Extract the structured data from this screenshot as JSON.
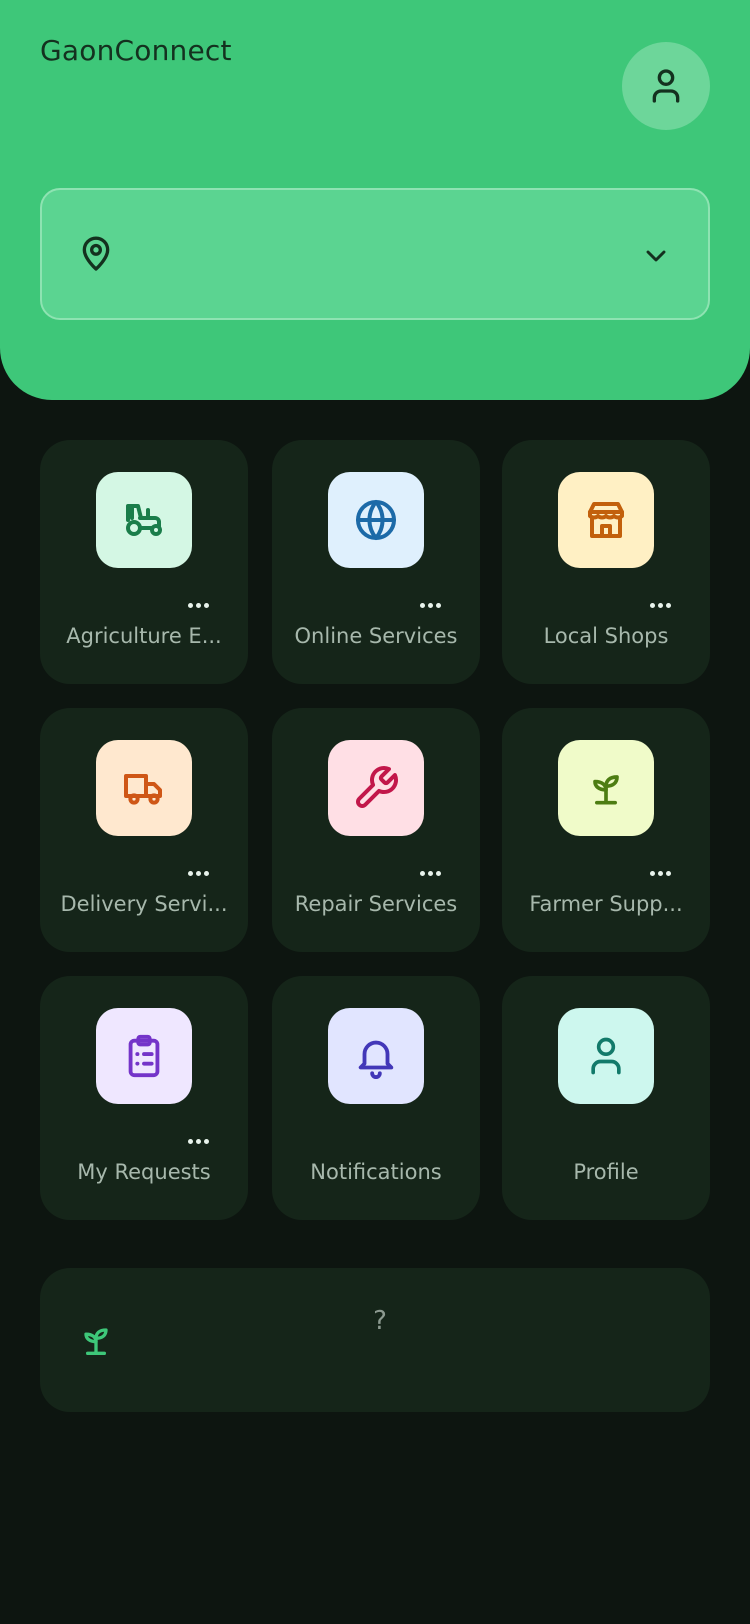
{
  "app": {
    "title": "GaonConnect"
  },
  "location": {
    "value": ""
  },
  "services": [
    {
      "label": "Agriculture E...",
      "icon": "tractor-icon",
      "tile_bg": "#d4f7e4",
      "icon_color": "#1a7d4a",
      "has_more": true
    },
    {
      "label": "Online Services",
      "icon": "globe-icon",
      "tile_bg": "#dff0fd",
      "icon_color": "#1c6aa8",
      "has_more": true
    },
    {
      "label": "Local Shops",
      "icon": "store-icon",
      "tile_bg": "#fff0c4",
      "icon_color": "#c2600c",
      "has_more": true
    },
    {
      "label": "Delivery Servi...",
      "icon": "truck-icon",
      "tile_bg": "#ffe8cf",
      "icon_color": "#cf5616",
      "has_more": true
    },
    {
      "label": "Repair Services",
      "icon": "wrench-icon",
      "tile_bg": "#ffdfe5",
      "icon_color": "#c2174a",
      "has_more": true
    },
    {
      "label": "Farmer Supp...",
      "icon": "sprout-icon",
      "tile_bg": "#f0fbc9",
      "icon_color": "#4d7d12",
      "has_more": true
    },
    {
      "label": "My Requests",
      "icon": "clipboard-list-icon",
      "tile_bg": "#efe7ff",
      "icon_color": "#7434c9",
      "has_more": true
    },
    {
      "label": "Notifications",
      "icon": "bell-icon",
      "tile_bg": "#e1e5ff",
      "icon_color": "#4237b8",
      "has_more": false
    },
    {
      "label": "Profile",
      "icon": "user-icon",
      "tile_bg": "#cdf7ee",
      "icon_color": "#127a6a",
      "has_more": false
    }
  ],
  "tip": {
    "text": "?"
  },
  "colors": {
    "header_bg": "#3ec779",
    "page_bg": "#0d1510",
    "card_bg": "#152519",
    "accent_green": "#3ec779"
  }
}
